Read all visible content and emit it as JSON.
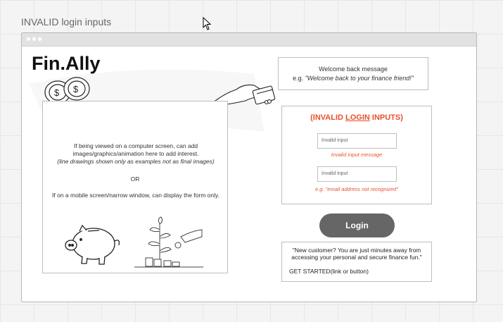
{
  "frame": {
    "title": "INVALID login inputs"
  },
  "app": {
    "logo": "Fin.Ally"
  },
  "hero": {
    "line1": "If being viewed on a computer screen, can add images/graphics/animation here to add interest.",
    "line2": "(line drawings shown only as examples not as final images)",
    "or": "OR",
    "mobile": "If on a mobile screen/narrow window, can display the form only."
  },
  "welcome": {
    "title": "Welcome back message",
    "prefix": "e.g. ",
    "example": "\"Welcome back to your finance friend!\""
  },
  "form": {
    "title_pre": "(INVALID ",
    "title_login": "LOGIN",
    "title_post": " INPUTS)",
    "input1_value": "Invalid input",
    "input1_error": "Invalid input message",
    "input2_value": "Invalid input",
    "input2_error": "e.g. \"email address not recognized\""
  },
  "login_button": "Login",
  "signup": {
    "message": "\"New customer? You are just minutes away from accessing your personal and secure finance fun.\"",
    "cta": "GET STARTED(link or button)"
  },
  "colors": {
    "accent": "#e8502d",
    "button": "#666666"
  }
}
